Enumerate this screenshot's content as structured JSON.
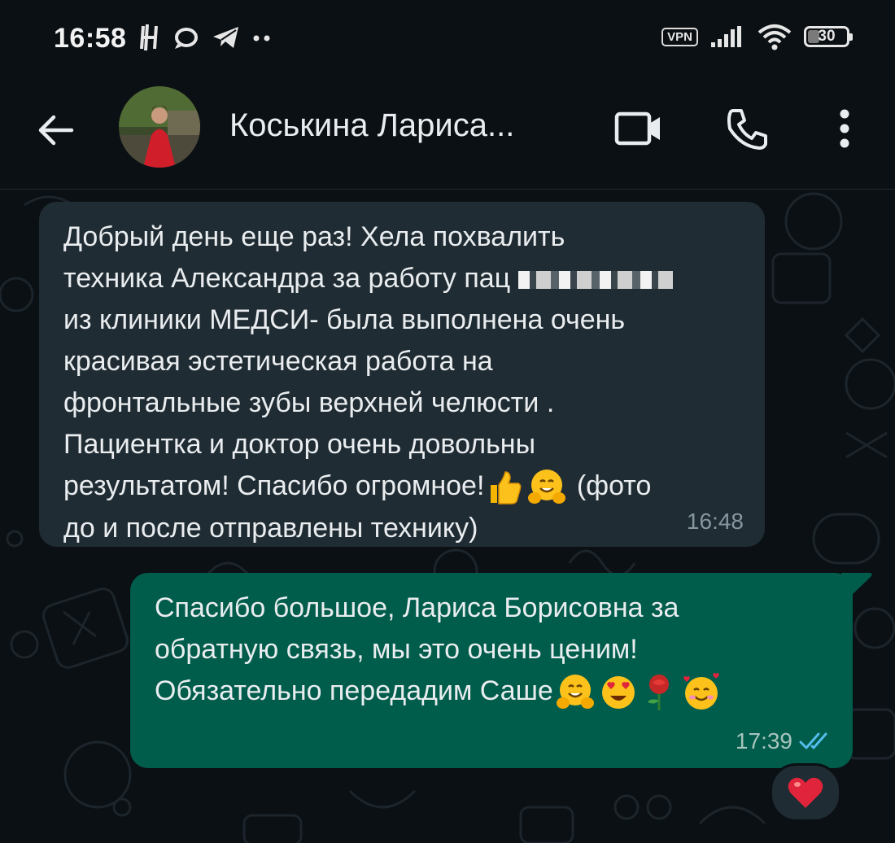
{
  "status_bar": {
    "time": "16:58",
    "left_icons": [
      "h-icon",
      "o-icon",
      "telegram-icon",
      "dots-icon"
    ],
    "vpn_label": "VPN",
    "battery_level": "30",
    "battery_fraction": 0.3
  },
  "header": {
    "contact_name": "Коськина Лариса...",
    "icons": [
      "back-arrow-icon",
      "video-camera-icon",
      "phone-icon",
      "more-vert-icon"
    ]
  },
  "messages": [
    {
      "direction": "incoming",
      "lines": [
        "Добрый день еще раз! Хела похвалить",
        "техника Александра за работу пац",
        "из клиники МЕДСИ- была выполнена очень",
        "красивая эстетическая работа на",
        "фронтальные зубы верхней челюсти  .",
        "Пациентка и доктор очень довольны",
        "результатом! Спасибо огромное!",
        " (фото",
        "до и после отправлены технику)"
      ],
      "emojis": [
        "thumbs-up-icon",
        "hugging-face-icon"
      ],
      "time": "16:48"
    },
    {
      "direction": "outgoing",
      "lines": [
        "Спасибо большое, Лариса Борисовна за",
        "обратную связь, мы это очень ценим!",
        "Обязательно передадим Саше"
      ],
      "emojis": [
        "hugging-face-icon",
        "heart-eyes-face-icon",
        "rose-icon",
        "smiling-face-hearts-icon"
      ],
      "time": "17:39",
      "status": "read",
      "reaction": "heart-icon"
    }
  ],
  "colors": {
    "background": "#0b1014",
    "incoming_bubble": "#202c33",
    "outgoing_bubble": "#005c4b",
    "read_ticks": "#53bdeb",
    "heart": "#e0243c"
  }
}
